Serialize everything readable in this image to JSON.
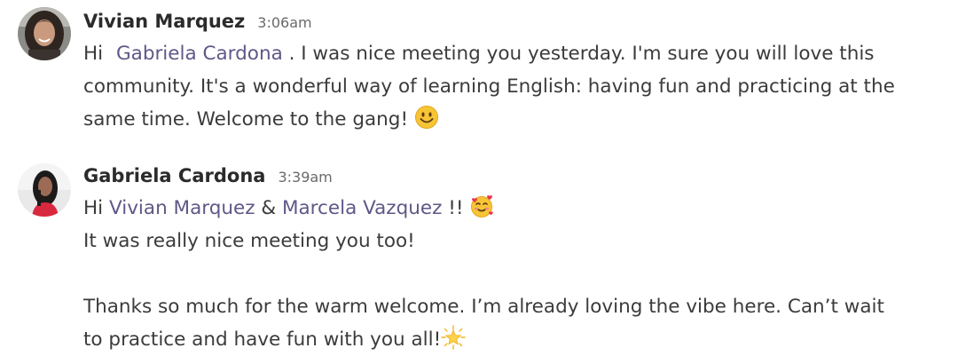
{
  "messages": [
    {
      "author": "Vivian Marquez",
      "time": "3:06am",
      "greeting": "Hi",
      "mention": "Gabriela Cardona",
      "line1_rest": ". I was nice meeting you yesterday. I'm sure you will love this",
      "line2": "community. It's a wonderful way of learning English: having fun and practicing at the",
      "line3": "same time. Welcome to the gang!",
      "emoji": "smiling-face-icon"
    },
    {
      "author": "Gabriela Cardona",
      "time": "3:39am",
      "greeting": "Hi",
      "mention1": "Vivian Marquez",
      "amp": "&",
      "mention2": "Marcela Vazquez",
      "exclaim": "!!",
      "emoji1": "smiling-face-with-hearts-icon",
      "line2": "It was really nice meeting you too!",
      "line4": "Thanks so much for the warm welcome. I’m already loving the vibe here. Can’t wait",
      "line5": "to practice and have fun with you all!",
      "emoji2": "glowing-star-icon"
    }
  ],
  "colors": {
    "mention": "#5e5887",
    "text": "#3b3b3b",
    "author": "#2b2b2b",
    "time": "#6a6a6a"
  }
}
